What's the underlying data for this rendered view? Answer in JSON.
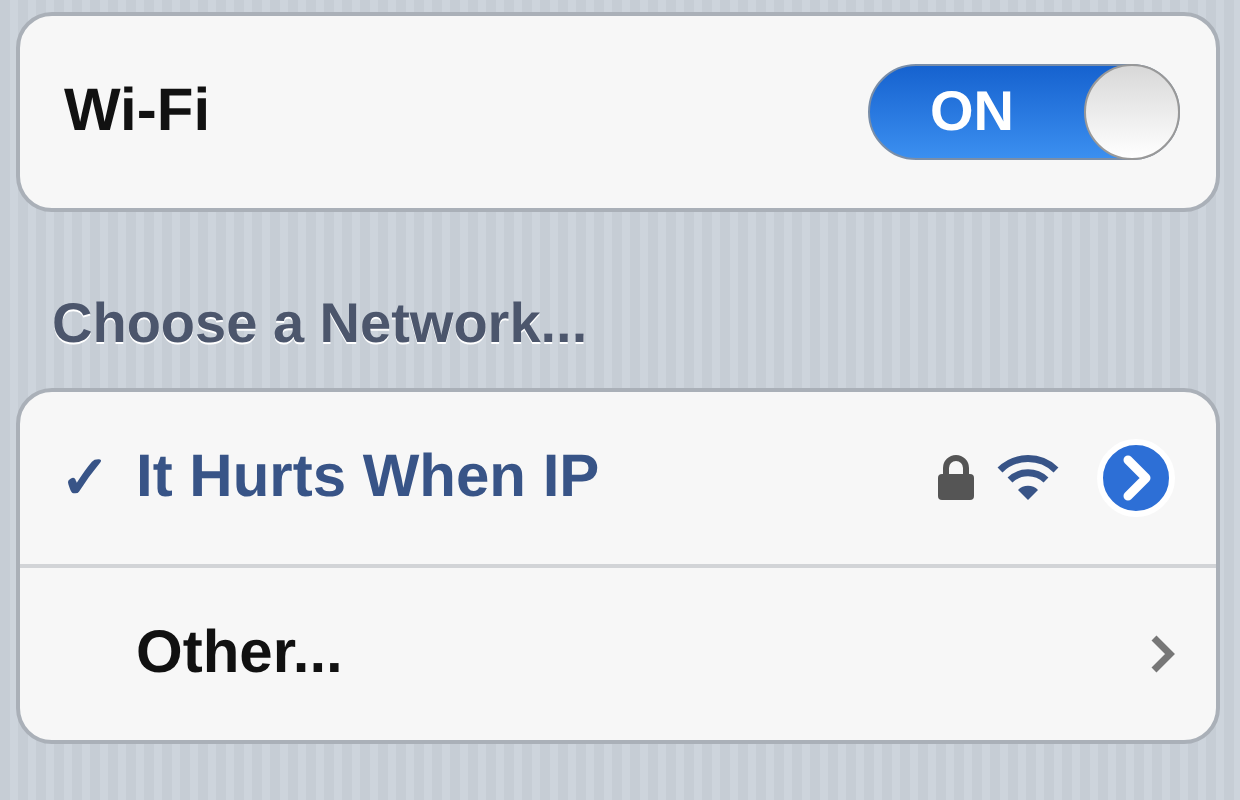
{
  "wifi": {
    "label": "Wi-Fi",
    "on": true,
    "toggle_text": "ON"
  },
  "section_title": "Choose a Network...",
  "networks": [
    {
      "kind": "network",
      "name": "It Hurts When IP",
      "selected": true,
      "mark": "✓",
      "secured": true
    },
    {
      "kind": "other",
      "name": "Other...",
      "selected": false
    }
  ]
}
